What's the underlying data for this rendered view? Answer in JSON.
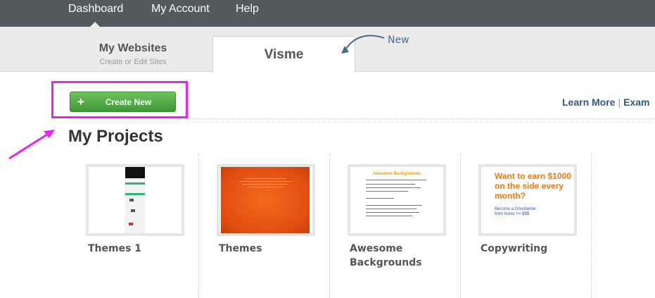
{
  "topnav": {
    "items": [
      "Dashboard",
      "My Account",
      "Help"
    ]
  },
  "tabs": {
    "websites_title": "My Websites",
    "websites_subtitle": "Create or Edit Sites",
    "visme_title": "Visme"
  },
  "annotation": {
    "new_label": "New",
    "highlight_color": "#ee22ee"
  },
  "toolbar": {
    "create_label": "Create New",
    "create_icon": "plus-icon"
  },
  "links": {
    "learn_more": "Learn More",
    "separator": "|",
    "examples": "Exam"
  },
  "projects": {
    "heading": "My Projects",
    "items": [
      {
        "name": "Themes 1"
      },
      {
        "name": "Themes"
      },
      {
        "name": "Awesome\nBackgrounds"
      },
      {
        "name": "Copywriting"
      }
    ],
    "thumb3_title": "Awesome Backgrounds",
    "thumb4_headline": "Want to earn $1000 on the side every month?",
    "thumb4_small": "Become a Ghostwriter from home >> $$$"
  },
  "colors": {
    "nav_bg": "#525a5e",
    "accent_green": "#3f9a37",
    "link_blue": "#2e5a88"
  }
}
